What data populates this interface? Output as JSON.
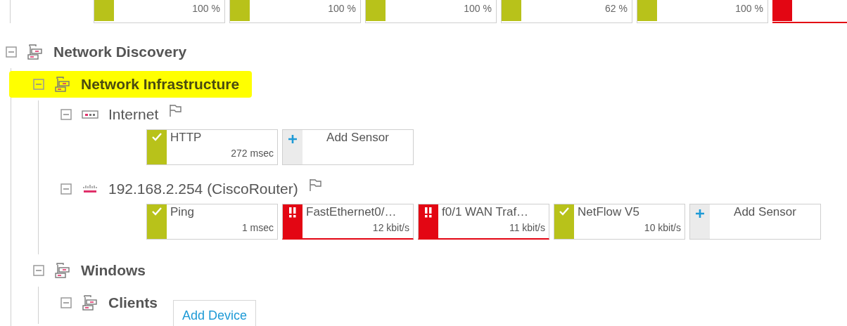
{
  "top_sensors": [
    {
      "kind": "ok",
      "value": "100 %"
    },
    {
      "kind": "ok",
      "value": "100 %"
    },
    {
      "kind": "ok",
      "value": "100 %"
    },
    {
      "kind": "ok",
      "value": "62 %"
    },
    {
      "kind": "ok",
      "value": "100 %"
    },
    {
      "kind": "down"
    }
  ],
  "tree": [
    {
      "kind": "group",
      "label": "Network Discovery",
      "expanded": true,
      "highlighted": false,
      "children": [
        {
          "kind": "group",
          "label": "Network Infrastructure",
          "expanded": true,
          "highlighted": true,
          "children": [
            {
              "kind": "device",
              "label": "Internet",
              "expanded": true,
              "highlighted": false,
              "sensors": [
                {
                  "kind": "ok",
                  "name": "HTTP",
                  "value": "272 msec"
                },
                {
                  "kind": "add",
                  "name": "Add Sensor"
                }
              ]
            },
            {
              "kind": "router",
              "label": "192.168.2.254 (CiscoRouter)",
              "expanded": true,
              "highlighted": false,
              "sensors": [
                {
                  "kind": "ok",
                  "name": "Ping",
                  "value": "1 msec"
                },
                {
                  "kind": "down",
                  "name": "FastEthernet0/…",
                  "value": "12 kbit/s"
                },
                {
                  "kind": "down",
                  "name": "f0/1 WAN Traf…",
                  "value": "11 kbit/s"
                },
                {
                  "kind": "ok",
                  "name": "NetFlow V5",
                  "value": "10 kbit/s"
                },
                {
                  "kind": "add",
                  "name": "Add Sensor"
                }
              ]
            }
          ]
        },
        {
          "kind": "group",
          "label": "Windows",
          "expanded": true,
          "highlighted": false,
          "children": [
            {
              "kind": "group",
              "label": "Clients",
              "expanded": true,
              "highlighted": false,
              "add_button": "Add Device"
            }
          ]
        }
      ]
    }
  ]
}
